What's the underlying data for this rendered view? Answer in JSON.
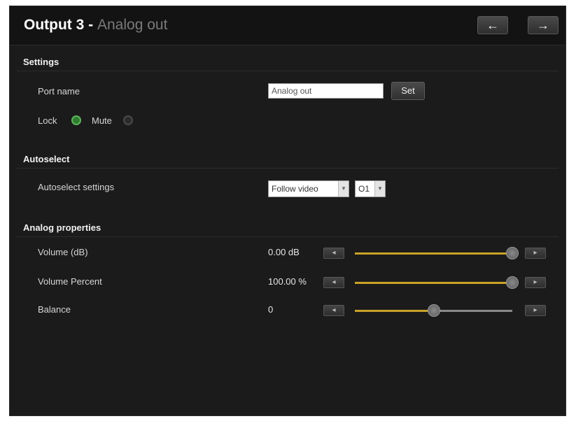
{
  "header": {
    "title": "Output 3 -",
    "subtitle": "Analog out",
    "prev_icon": "←",
    "next_icon": "→"
  },
  "settings": {
    "title": "Settings",
    "port_name_label": "Port name",
    "port_name_value": "Analog out",
    "set_label": "Set",
    "lock_label": "Lock",
    "mute_label": "Mute",
    "lock_state": "on",
    "mute_state": "off"
  },
  "autoselect": {
    "title": "Autoselect",
    "settings_label": "Autoselect settings",
    "mode_value": "Follow video",
    "channel_value": "O1"
  },
  "analog": {
    "title": "Analog properties",
    "rows": [
      {
        "label": "Volume (dB)",
        "value": "0.00 dB",
        "level": 1.0
      },
      {
        "label": "Volume Percent",
        "value": "100.00 %",
        "level": 1.0
      },
      {
        "label": "Balance",
        "value": "0",
        "level": 0.5
      }
    ]
  },
  "colors": {
    "accent_track": "#c9a227",
    "track_rest": "#8a8a8a",
    "lock_on": "#3aa03a"
  }
}
